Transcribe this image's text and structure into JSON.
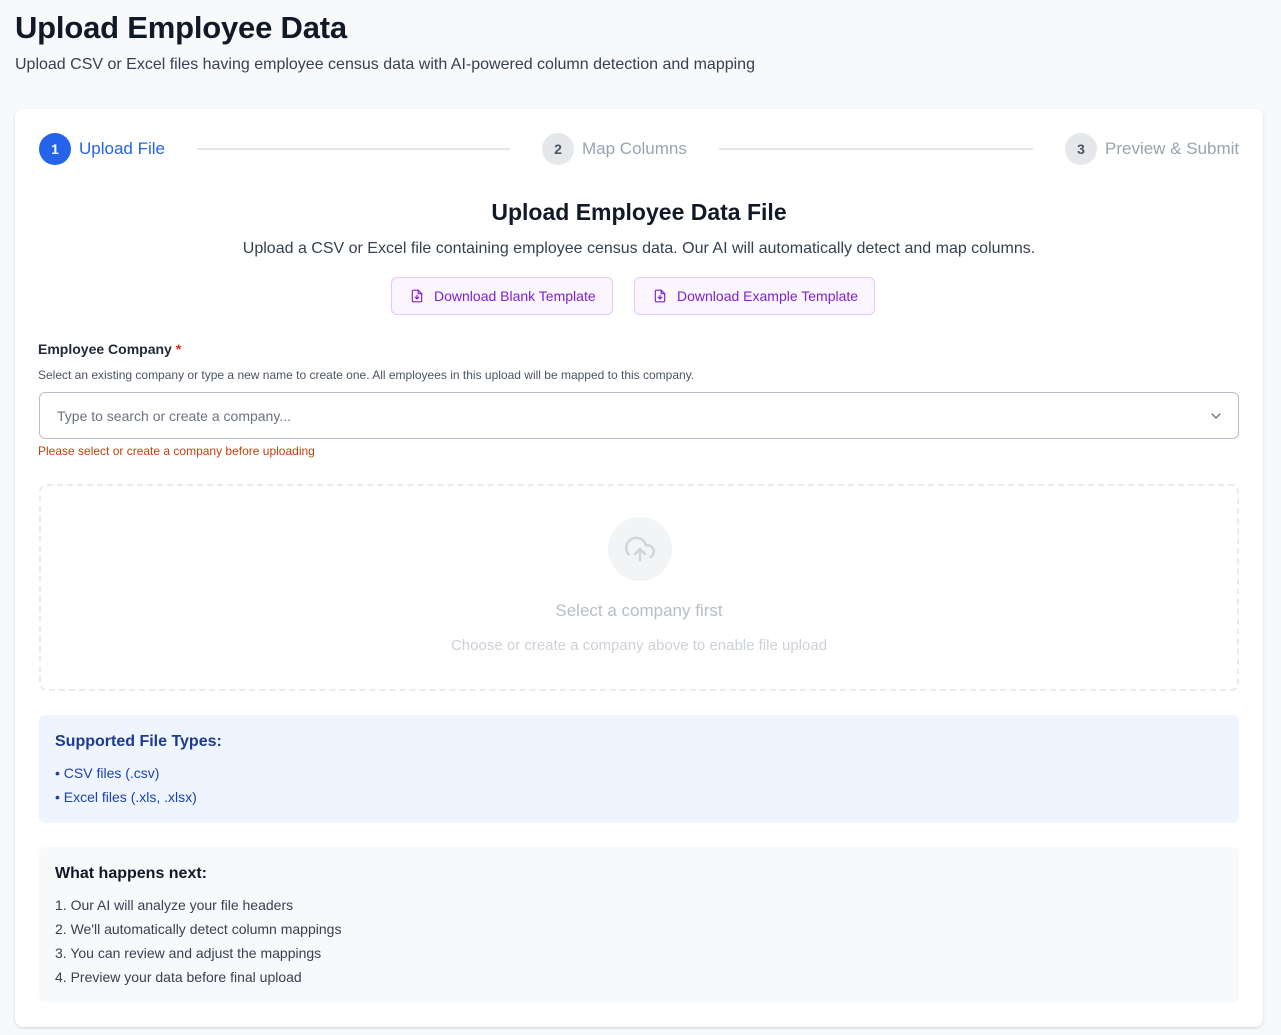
{
  "header": {
    "title": "Upload Employee Data",
    "subtitle": "Upload CSV or Excel files having employee census data with AI-powered column detection and mapping"
  },
  "stepper": {
    "current_step": 1,
    "steps": [
      {
        "number": "1",
        "label": "Upload File",
        "state": "active"
      },
      {
        "number": "2",
        "label": "Map Columns",
        "state": "inactive"
      },
      {
        "number": "3",
        "label": "Preview & Submit",
        "state": "inactive"
      }
    ]
  },
  "upload_section": {
    "title": "Upload Employee Data File",
    "description": "Upload a CSV or Excel file containing employee census data. Our AI will automatically detect and map columns.",
    "download_blank_label": "Download Blank Template",
    "download_example_label": "Download Example Template"
  },
  "company_field": {
    "label": "Employee Company",
    "required_marker": "*",
    "help_text": "Select an existing company or type a new name to create one. All employees in this upload will be mapped to this company.",
    "placeholder": "Type to search or create a company...",
    "value": "",
    "warning": "Please select or create a company before uploading"
  },
  "dropzone": {
    "icon": "upload-cloud-icon",
    "title": "Select a company first",
    "description": "Choose or create a company above to enable file upload",
    "disabled": true
  },
  "supported_types": {
    "title": "Supported File Types:",
    "items": [
      "• CSV files (.csv)",
      "• Excel files (.xls, .xlsx)"
    ]
  },
  "next_steps": {
    "title": "What happens next:",
    "items": [
      "1. Our AI will analyze your file headers",
      "2. We'll automatically detect column mappings",
      "3. You can review and adjust the mappings",
      "4. Preview your data before final upload"
    ]
  },
  "colors": {
    "primary": "#2563eb",
    "template_button_text": "#7e22ce",
    "warning": "#c2410c",
    "info_background": "#eef5ff"
  }
}
